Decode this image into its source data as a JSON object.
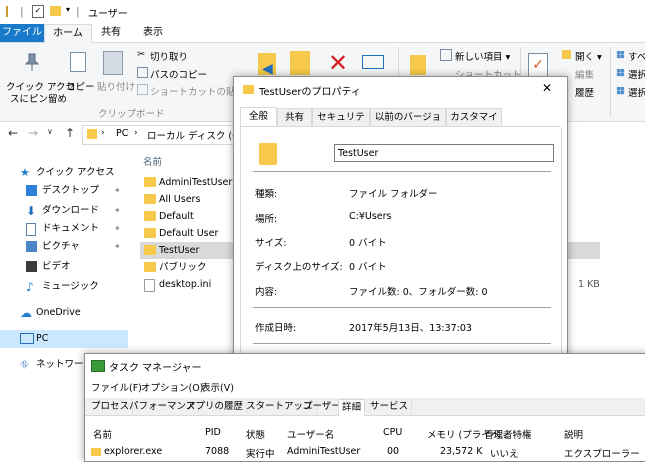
{
  "explorer": {
    "title": "ユーザー",
    "tabs": {
      "file": "ファイル",
      "home": "ホーム",
      "share": "共有",
      "view": "表示"
    },
    "ribbon": {
      "pin_quick_access": "クイック アクセス\nにピン留め",
      "pin_line1": "クイック アクセ",
      "pin_line2": "スにピン留め",
      "copy": "コピー",
      "paste": "貼り付け",
      "cut": "切り取り",
      "copy_path": "パスのコピー",
      "paste_shortcut": "ショートカットの貼り付け",
      "clipboard_group": "クリップボード",
      "new_item": "新しい項目",
      "shortcut": "ショートカット",
      "open": "開く",
      "edit": "編集",
      "history": "履歴",
      "sel_all": "すべ",
      "sel_none": "選択",
      "sel_invert": "選択"
    },
    "address": {
      "pc": "PC",
      "drive": "ローカル ディスク (C:)"
    },
    "column_name": "名前",
    "nav": [
      {
        "label": "クイック アクセス",
        "icon": "star-icon",
        "color": "#1e7fd0"
      },
      {
        "label": "デスクトップ",
        "icon": "desktop-icon",
        "color": "#2f7fd8",
        "pin": true
      },
      {
        "label": "ダウンロード",
        "icon": "download-icon",
        "color": "#1e6fc0",
        "pin": true
      },
      {
        "label": "ドキュメント",
        "icon": "document-icon",
        "color": "#5b7fa8",
        "pin": true
      },
      {
        "label": "ピクチャ",
        "icon": "picture-icon",
        "color": "#4a86c8",
        "pin": true
      },
      {
        "label": "ビデオ",
        "icon": "video-icon",
        "color": "#3a3a3a"
      },
      {
        "label": "ミュージック",
        "icon": "music-icon",
        "color": "#1e7fd0"
      },
      {
        "label": "OneDrive",
        "icon": "cloud-icon",
        "color": "#1e7fd0"
      },
      {
        "label": "PC",
        "icon": "computer-icon",
        "color": "#2a6db8"
      },
      {
        "label": "ネットワーク",
        "icon": "network-icon",
        "color": "#2a6db8"
      }
    ],
    "files": [
      {
        "name": "AdminiTestUser"
      },
      {
        "name": "All Users"
      },
      {
        "name": "Default"
      },
      {
        "name": "Default User"
      },
      {
        "name": "TestUser",
        "selected": true
      },
      {
        "name": "パブリック"
      },
      {
        "name": "desktop.ini",
        "size": "1 KB"
      }
    ]
  },
  "properties": {
    "title": "TestUserのプロパティ",
    "tabs": [
      "全般",
      "共有",
      "セキュリティ",
      "以前のバージョン",
      "カスタマイズ"
    ],
    "name_value": "TestUser",
    "rows": [
      {
        "label": "種類:",
        "value": "ファイル フォルダー"
      },
      {
        "label": "場所:",
        "value": "C:¥Users"
      },
      {
        "label": "サイズ:",
        "value": "0 バイト"
      },
      {
        "label": "ディスク上のサイズ:",
        "value": "0 バイト"
      },
      {
        "label": "内容:",
        "value": "ファイル数: 0、フォルダー数: 0"
      },
      {
        "label": "作成日時:",
        "value": "2017年5月13日、13:37:03"
      }
    ],
    "close": "✕"
  },
  "taskmgr": {
    "title": "タスク マネージャー",
    "menu": [
      "ファイル(F)",
      "オプション(O)",
      "表示(V)"
    ],
    "tabs": [
      "プロセス",
      "パフォーマンス",
      "アプリの履歴",
      "スタートアップ",
      "ユーザー",
      "詳細",
      "サービス"
    ],
    "columns": [
      "名前",
      "PID",
      "状態",
      "ユーザー名",
      "CPU",
      "メモリ (プライベ...",
      "管理者特権",
      "説明"
    ],
    "row": [
      "explorer.exe",
      "7088",
      "実行中",
      "AdminiTestUser",
      "00",
      "23,572 K",
      "いいえ",
      "エクスプローラー"
    ]
  }
}
